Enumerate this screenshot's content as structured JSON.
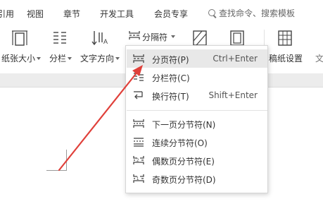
{
  "menubar": {
    "tabs": [
      "引用",
      "视图",
      "章节",
      "开发工具",
      "会员专享"
    ],
    "search_label": "查找命令、搜索模板"
  },
  "ribbon": {
    "paper_size": "纸张大小",
    "columns": "分栏",
    "text_direction": "文字方向",
    "separator_button": "分隔符",
    "paper_settings": "稿纸设置",
    "cut_off": "文"
  },
  "dropdown": {
    "items": [
      {
        "label": "分页符(P)",
        "shortcut": "Ctrl+Enter",
        "icon": "page-break-icon"
      },
      {
        "label": "分栏符(C)",
        "shortcut": "",
        "icon": "column-break-icon"
      },
      {
        "label": "换行符(T)",
        "shortcut": "Shift+Enter",
        "icon": "line-break-icon"
      },
      {
        "label": "下一页分节符(N)",
        "shortcut": "",
        "icon": "section-break-next-page-icon"
      },
      {
        "label": "连续分节符(O)",
        "shortcut": "",
        "icon": "section-break-continuous-icon"
      },
      {
        "label": "偶数页分节符(E)",
        "shortcut": "",
        "icon": "section-break-even-page-icon"
      },
      {
        "label": "奇数页分节符(D)",
        "shortcut": "",
        "icon": "section-break-odd-page-icon"
      }
    ]
  },
  "colors": {
    "arrow": "#e0403a",
    "highlight": "#e8e8e8",
    "band": "#ececec"
  }
}
